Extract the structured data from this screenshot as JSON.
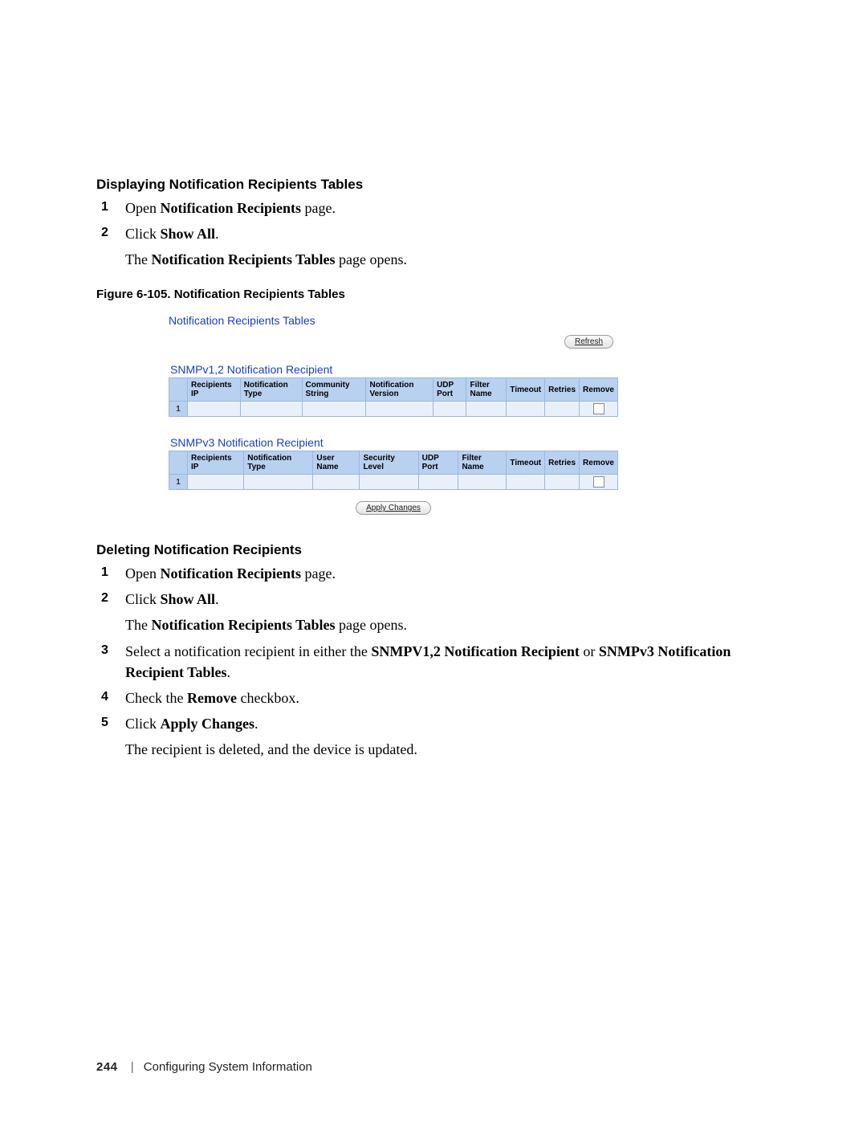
{
  "section1": {
    "heading": "Displaying Notification Recipients Tables",
    "steps": [
      {
        "num": "1",
        "pre": "Open ",
        "bold": "Notification Recipients",
        "post": " page."
      },
      {
        "num": "2",
        "pre": "Click ",
        "bold": "Show All",
        "post": "."
      }
    ],
    "after_pre": "The ",
    "after_bold": "Notification Recipients Tables",
    "after_post": " page opens."
  },
  "figure": {
    "caption": "Figure 6-105.    Notification Recipients Tables",
    "title": "Notification Recipients Tables",
    "refresh": "Refresh",
    "t1": {
      "title": "SNMPv1,2 Notification Recipient",
      "headers": [
        "Recipients IP",
        "Notification Type",
        "Community String",
        "Notification Version",
        "UDP Port",
        "Filter Name",
        "Timeout",
        "Retries",
        "Remove"
      ],
      "row_idx": "1"
    },
    "t2": {
      "title": "SNMPv3 Notification Recipient",
      "headers": [
        "Recipients IP",
        "Notification Type",
        "User Name",
        "Security Level",
        "UDP Port",
        "Filter Name",
        "Timeout",
        "Retries",
        "Remove"
      ],
      "row_idx": "1"
    },
    "apply": "Apply Changes"
  },
  "section2": {
    "heading": "Deleting Notification Recipients",
    "s1": {
      "num": "1",
      "pre": "Open ",
      "bold": "Notification Recipients",
      "post": " page."
    },
    "s2": {
      "num": "2",
      "pre": "Click ",
      "bold": "Show All",
      "post": "."
    },
    "s2after_pre": "The ",
    "s2after_bold": "Notification Recipients Tables",
    "s2after_post": " page opens.",
    "s3": {
      "num": "3",
      "pre": "Select a notification recipient in either the ",
      "bold1": "SNMPV1,2 Notification Recipient",
      "mid": " or ",
      "bold2": "SNMPv3 Notification Recipient Tables",
      "post": "."
    },
    "s4": {
      "num": "4",
      "pre": "Check the ",
      "bold": "Remove",
      "post": " checkbox."
    },
    "s5": {
      "num": "5",
      "pre": "Click ",
      "bold": "Apply Changes",
      "post": "."
    },
    "s5after": "The recipient is deleted, and the device is updated."
  },
  "footer": {
    "page": "244",
    "title": "Configuring System Information"
  }
}
